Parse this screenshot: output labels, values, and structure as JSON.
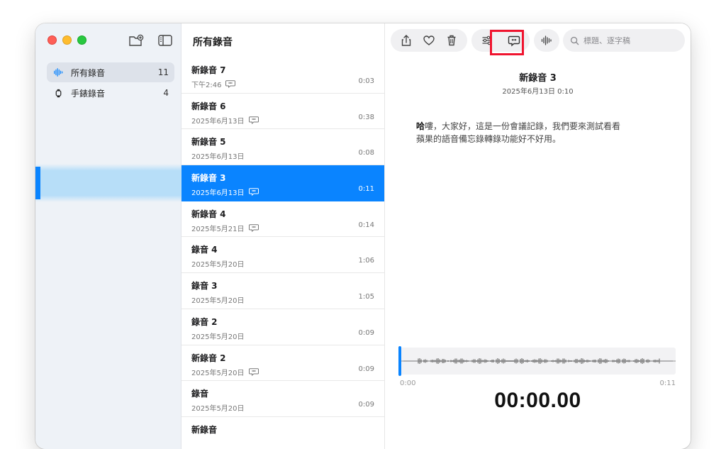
{
  "sidebar": {
    "items": [
      {
        "label": "所有錄音",
        "count": "11",
        "icon": "waveform-icon"
      },
      {
        "label": "手錶錄音",
        "count": "4",
        "icon": "watch-icon"
      }
    ]
  },
  "list": {
    "title": "所有錄音",
    "rows": [
      {
        "name": "新錄音 7",
        "date": "下午2:46",
        "duration": "0:03",
        "transcript": true
      },
      {
        "name": "新錄音 6",
        "date": "2025年6月13日",
        "duration": "0:38",
        "transcript": true
      },
      {
        "name": "新錄音 5",
        "date": "2025年6月13日",
        "duration": "0:08",
        "transcript": false
      },
      {
        "name": "新錄音 3",
        "date": "2025年6月13日",
        "duration": "0:11",
        "transcript": true
      },
      {
        "name": "新錄音 4",
        "date": "2025年5月21日",
        "duration": "0:14",
        "transcript": true
      },
      {
        "name": "錄音 4",
        "date": "2025年5月20日",
        "duration": "1:06",
        "transcript": false
      },
      {
        "name": "錄音 3",
        "date": "2025年5月20日",
        "duration": "1:05",
        "transcript": false
      },
      {
        "name": "錄音 2",
        "date": "2025年5月20日",
        "duration": "0:09",
        "transcript": false
      },
      {
        "name": "新錄音 2",
        "date": "2025年5月20日",
        "duration": "0:09",
        "transcript": true
      },
      {
        "name": "錄音",
        "date": "2025年5月20日",
        "duration": "0:09",
        "transcript": false
      },
      {
        "name": "新錄音",
        "date": "",
        "duration": "",
        "transcript": false
      }
    ]
  },
  "detail": {
    "title": "新錄音 3",
    "subtitle": "2025年6月13日   0:10",
    "transcript_first": "哈",
    "transcript_rest": "嘍，大家好，這是一份會議記錄，我們要來測試看看蘋果的語音備忘錄轉錄功能好不好用。",
    "search_placeholder": "標題、逐字稿",
    "time_start": "0:00",
    "time_end": "0:11",
    "timer": "00:00.00",
    "highlight_color": "#f0142f",
    "accent_color": "#0a84ff"
  }
}
